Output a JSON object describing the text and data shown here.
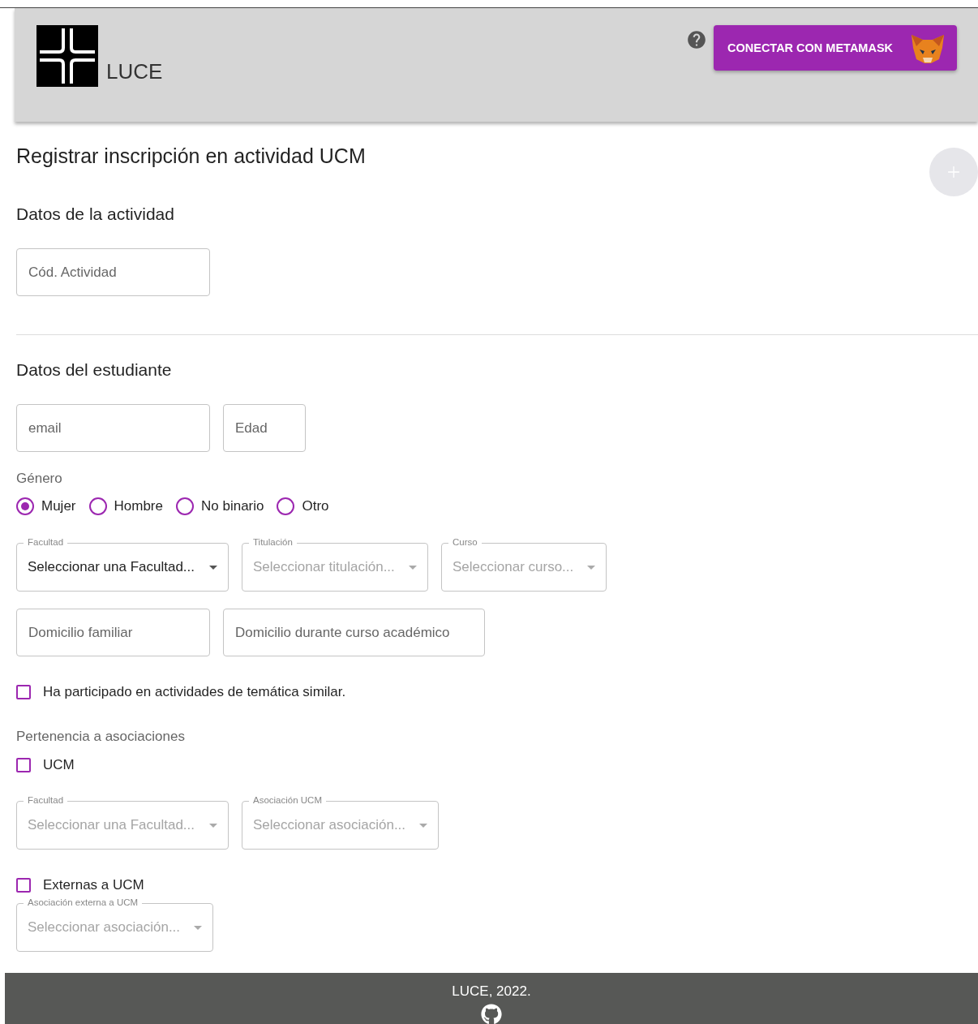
{
  "header": {
    "brand": "LUCE",
    "connect_button": "CONECTAR CON METAMASK"
  },
  "page_title": "Registrar inscripción en actividad UCM",
  "add_button": {
    "disabled": true
  },
  "activity": {
    "heading": "Datos de la actividad",
    "fields": [
      {
        "placeholder": "Cód. Actividad"
      }
    ]
  },
  "student": {
    "heading": "Datos del estudiante",
    "fields": [
      {
        "placeholder": "email"
      },
      {
        "placeholder": "Edad"
      }
    ],
    "gender": {
      "label": "Género",
      "options": [
        {
          "label": "Mujer",
          "selected": true
        },
        {
          "label": "Hombre",
          "selected": false
        },
        {
          "label": "No binario",
          "selected": false
        },
        {
          "label": "Otro",
          "selected": false
        }
      ]
    },
    "selects": [
      {
        "label": "Facultad",
        "value": "Seleccionar una Facultad...",
        "disabled": false
      },
      {
        "label": "Titulación",
        "value": "Seleccionar titulación...",
        "disabled": true
      },
      {
        "label": "Curso",
        "value": "Seleccionar curso...",
        "disabled": true
      }
    ],
    "address_fields": [
      {
        "placeholder": "Domicilio familiar"
      },
      {
        "placeholder": "Domicilio durante curso académico"
      }
    ],
    "similar": {
      "label": "Ha participado en actividades de temática similar.",
      "checked": false
    }
  },
  "associations": {
    "heading": "Pertenencia a asociaciones",
    "ucm": {
      "label": "UCM",
      "checked": false,
      "selects": [
        {
          "label": "Facultad",
          "value": "Seleccionar una Facultad...",
          "disabled": true
        },
        {
          "label": "Asociación UCM",
          "value": "Seleccionar asociación...",
          "disabled": true
        }
      ]
    },
    "external": {
      "label": "Externas a UCM",
      "checked": false,
      "selects": [
        {
          "label": "Asociación externa a UCM",
          "value": "Seleccionar asociación...",
          "disabled": true
        }
      ]
    }
  },
  "footer": {
    "text": "LUCE, 2022."
  }
}
